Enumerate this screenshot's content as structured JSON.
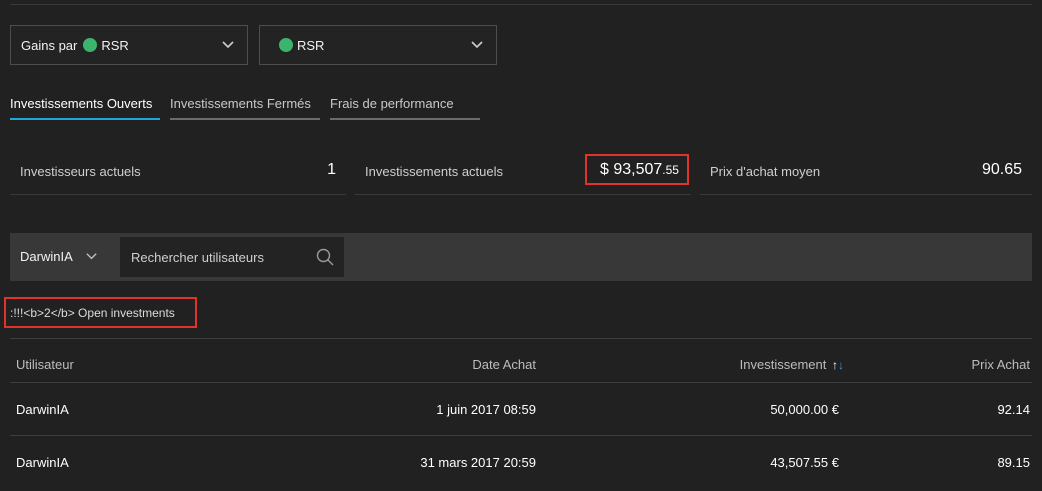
{
  "filters": {
    "gains_prefix": "Gains par",
    "gains_asset": "RSR",
    "asset_select": "RSR",
    "status_color": "#3cb46e"
  },
  "tabs": [
    {
      "label": "Investissements Ouverts",
      "active": true
    },
    {
      "label": "Investissements Fermés",
      "active": false
    },
    {
      "label": "Frais de performance",
      "active": false
    }
  ],
  "stats": {
    "investors_label": "Investisseurs actuels",
    "investors_value": "1",
    "investments_label": "Investissements actuels",
    "investments_value_main": "$ 93,507",
    "investments_value_cents": ".55",
    "avg_price_label": "Prix d'achat moyen",
    "avg_price_value": "90.65"
  },
  "filterbar": {
    "user_select": "DarwinIA",
    "search_placeholder": "Rechercher utilisateurs"
  },
  "open_investments_text": ":!!!<b>2</b> Open investments",
  "table": {
    "headers": {
      "user": "Utilisateur",
      "date": "Date Achat",
      "investment": "Investissement",
      "price": "Prix Achat"
    },
    "rows": [
      {
        "user": "DarwinIA",
        "date": "1 juin 2017 08:59",
        "investment": "50,000.00 €",
        "price": "92.14"
      },
      {
        "user": "DarwinIA",
        "date": "31 mars 2017 20:59",
        "investment": "43,507.55 €",
        "price": "89.15"
      }
    ]
  },
  "colors": {
    "accent": "#21a6d8",
    "highlight_border": "#e0332b",
    "background": "#212121"
  }
}
